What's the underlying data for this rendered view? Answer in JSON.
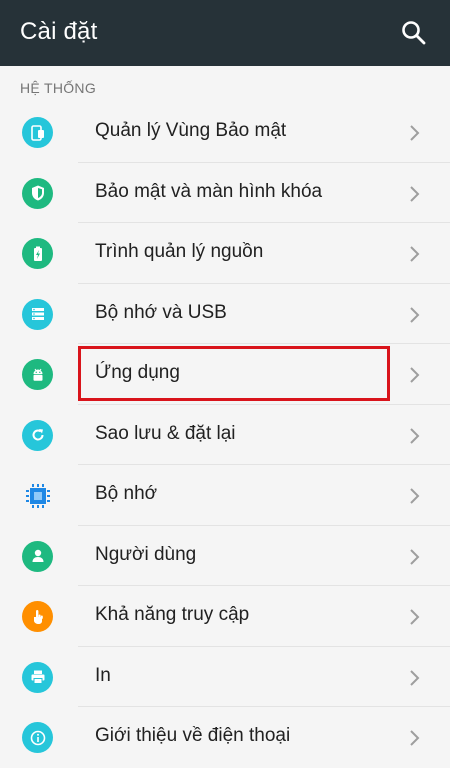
{
  "appbar": {
    "title": "Cài đặt",
    "search_icon": "search-icon"
  },
  "section": {
    "header": "HỆ THỐNG"
  },
  "items": [
    {
      "label": "Quản lý Vùng Bảo mật",
      "icon": "secure-folder-icon",
      "color": "#26c6da"
    },
    {
      "label": "Bảo mật và màn hình khóa",
      "icon": "shield-icon",
      "color": "#1eb980"
    },
    {
      "label": "Trình quản lý nguồn",
      "icon": "battery-icon",
      "color": "#1eb980"
    },
    {
      "label": "Bộ nhớ và USB",
      "icon": "storage-icon",
      "color": "#26c6da"
    },
    {
      "label": "Ứng dụng",
      "icon": "android-icon",
      "color": "#1eb980"
    },
    {
      "label": "Sao lưu & đặt lại",
      "icon": "backup-icon",
      "color": "#26c6da"
    },
    {
      "label": "Bộ nhớ",
      "icon": "memory-chip-icon",
      "color": "#1e88e5"
    },
    {
      "label": "Người dùng",
      "icon": "user-icon",
      "color": "#1eb980"
    },
    {
      "label": "Khả năng truy cập",
      "icon": "accessibility-hand-icon",
      "color": "#ff8f00"
    },
    {
      "label": "In",
      "icon": "printer-icon",
      "color": "#26c6da"
    },
    {
      "label": "Giới thiệu về điện thoại",
      "icon": "info-icon",
      "color": "#26c6da"
    }
  ],
  "colors": {
    "appbar_bg": "#263238",
    "highlight_border": "#d9141b",
    "background": "#f5f5f5"
  },
  "highlight_target": "Ứng dụng"
}
